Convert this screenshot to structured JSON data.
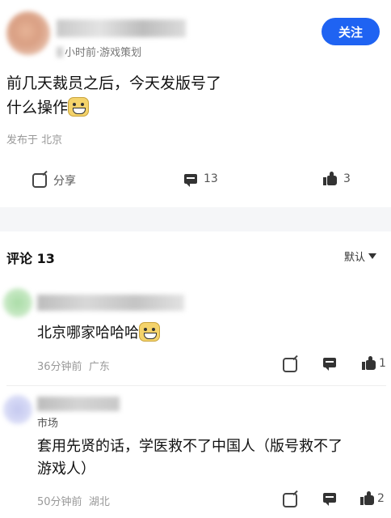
{
  "post": {
    "author_name": "",
    "meta": "小时前·游戏策划",
    "follow_label": "关注",
    "text_line1": "前几天裁员之后，今天发版号了",
    "text_line2": "什么操作",
    "posted_in": "发布于 北京",
    "actions": {
      "share_label": "分享",
      "comment_count": "13",
      "like_count": "3"
    }
  },
  "comments_section": {
    "title": "评论 13",
    "sort_label": "默认"
  },
  "comments": [
    {
      "text": "北京哪家哈哈哈",
      "time": "36分钟前",
      "location": "广东",
      "like_count": "1"
    },
    {
      "tag": "市场",
      "text_line1": "套用先贤的话，学医救不了中国人（版号救不了",
      "text_line2": "游戏人）",
      "time": "50分钟前",
      "location": "湖北",
      "like_count": "2"
    }
  ],
  "colors": {
    "accent": "#1f63f2",
    "divider": "#f5f6f8"
  }
}
